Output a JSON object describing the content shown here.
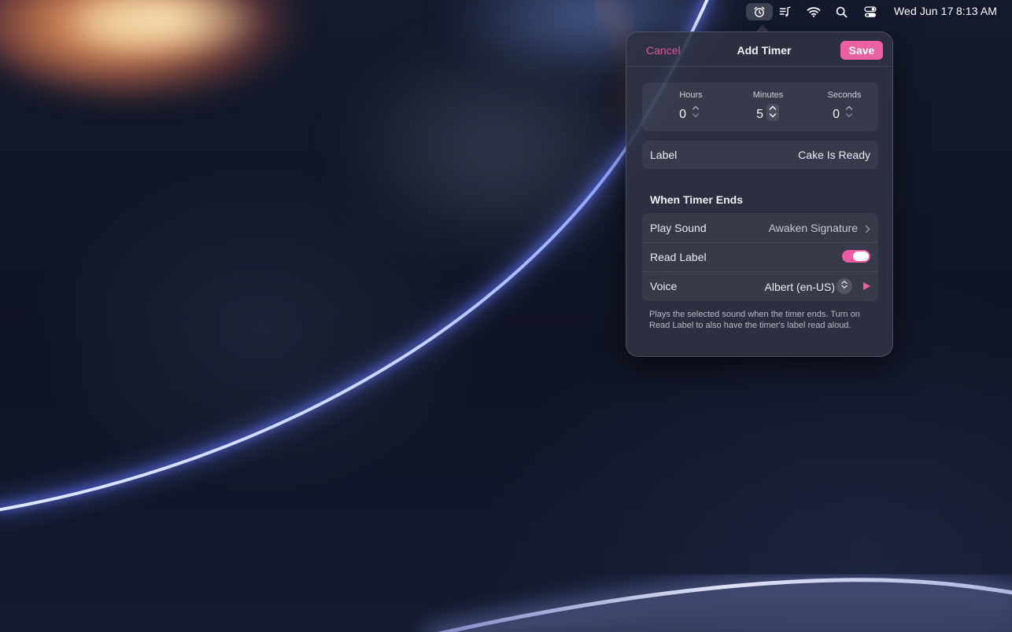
{
  "menubar": {
    "icons": [
      "alarm-clock-icon",
      "music-icon",
      "wifi-icon",
      "search-icon",
      "control-center-icon"
    ],
    "date": "Wed Jun 17",
    "time": "8:13 AM"
  },
  "popover": {
    "header": {
      "cancel_label": "Cancel",
      "title": "Add Timer",
      "save_label": "Save"
    },
    "duration": {
      "hours": {
        "label": "Hours",
        "value": "0"
      },
      "minutes": {
        "label": "Minutes",
        "value": "5"
      },
      "seconds": {
        "label": "Seconds",
        "value": "0"
      }
    },
    "label_row": {
      "title": "Label",
      "value": "Cake Is Ready"
    },
    "when_timer_ends": {
      "section_title": "When Timer Ends",
      "play_sound": {
        "title": "Play Sound",
        "value": "Awaken Signature"
      },
      "read_label": {
        "title": "Read Label",
        "enabled": true
      },
      "voice": {
        "title": "Voice",
        "value": "Albert (en-US)"
      }
    },
    "footer_note": "Plays the selected sound when the timer ends. Turn on Read Label to also have the timer's label read aloud."
  },
  "colors": {
    "accent": "#ec5fa0",
    "popover_bg": "#2f3242"
  }
}
